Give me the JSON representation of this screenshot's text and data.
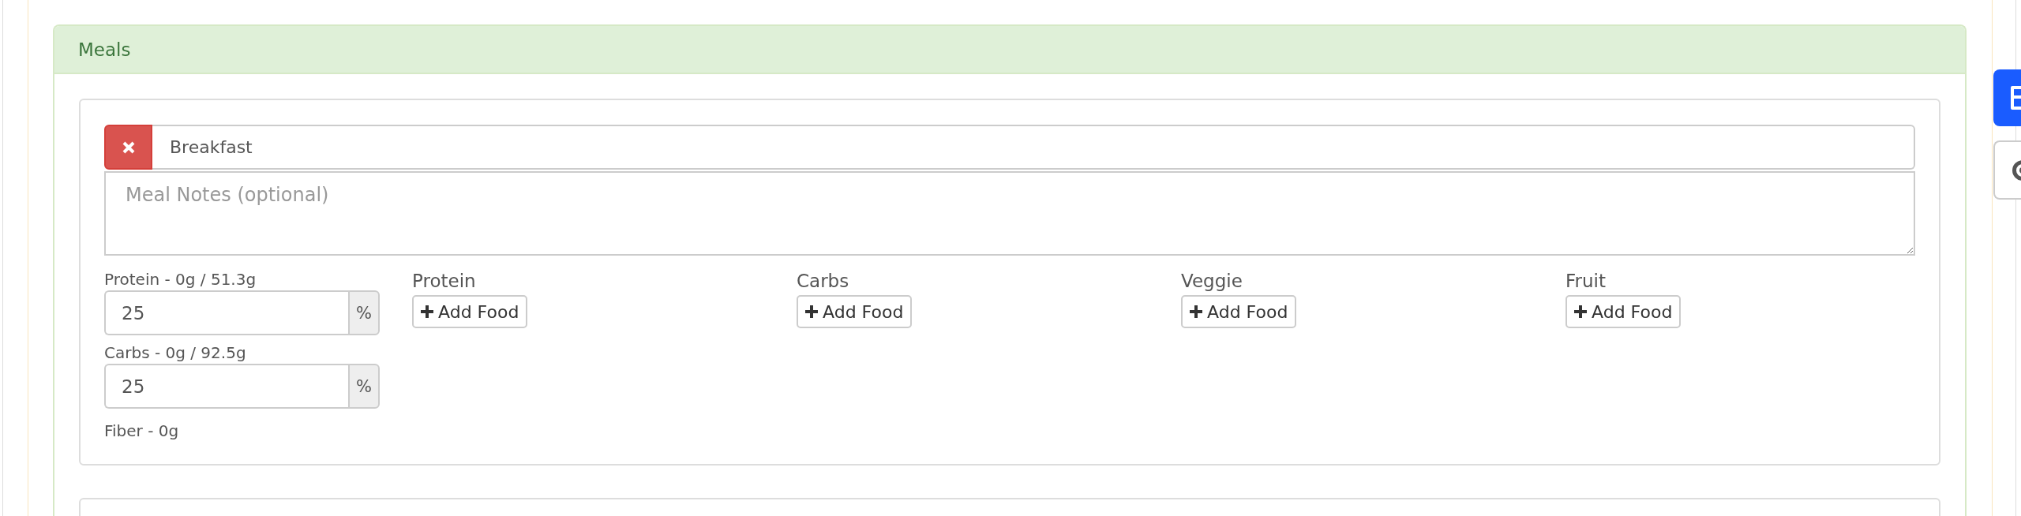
{
  "panel": {
    "title": "Meals"
  },
  "meals": [
    {
      "name": "Breakfast",
      "notes_placeholder": "Meal Notes (optional)",
      "macros": [
        {
          "label": "Protein - 0g / 51.3g",
          "value": "25",
          "unit": "%"
        },
        {
          "label": "Carbs - 0g / 92.5g",
          "value": "25",
          "unit": "%"
        }
      ],
      "fiber": "Fiber - 0g",
      "food_groups": [
        {
          "title": "Protein",
          "button": "Add Food"
        },
        {
          "title": "Carbs",
          "button": "Add Food"
        },
        {
          "title": "Veggie",
          "button": "Add Food"
        },
        {
          "title": "Fruit",
          "button": "Add Food"
        }
      ]
    }
  ],
  "side_buttons": [
    {
      "kind": "save"
    },
    {
      "kind": "target"
    }
  ]
}
